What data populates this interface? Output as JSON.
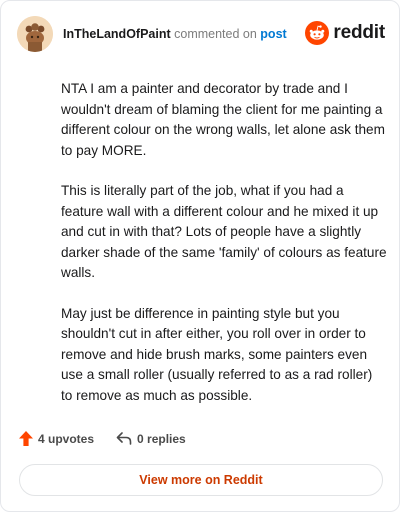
{
  "header": {
    "username": "InTheLandOfPaint",
    "action_text": "commented on",
    "post_link": "post",
    "brand": "reddit"
  },
  "comment": {
    "paragraphs": [
      "NTA I am a painter and decorator by trade and I wouldn't dream of blaming the client for me painting a different colour on the wrong walls, let alone ask them to pay MORE.",
      "This is literally part of the job, what if you had a feature wall with a different colour and he mixed it up and cut in with that? Lots of people have a slightly darker shade of the same 'family' of colours as feature walls.",
      "May just be difference in painting style but you shouldn't cut in after either, you roll over in order to remove and hide brush marks, some painters even use a small roller (usually referred to as a rad roller) to remove as much as possible."
    ]
  },
  "footer": {
    "upvotes": "4 upvotes",
    "replies": "0 replies",
    "view_button": "View more on Reddit"
  },
  "colors": {
    "upvote": "#ff4500",
    "link": "#0079d3",
    "view_button_text": "#cc3a00"
  },
  "icons": {
    "avatar": "snoo-avatar-icon",
    "logo": "reddit-snoo-icon",
    "upvote": "upvote-arrow-icon",
    "reply": "reply-arrow-icon"
  }
}
